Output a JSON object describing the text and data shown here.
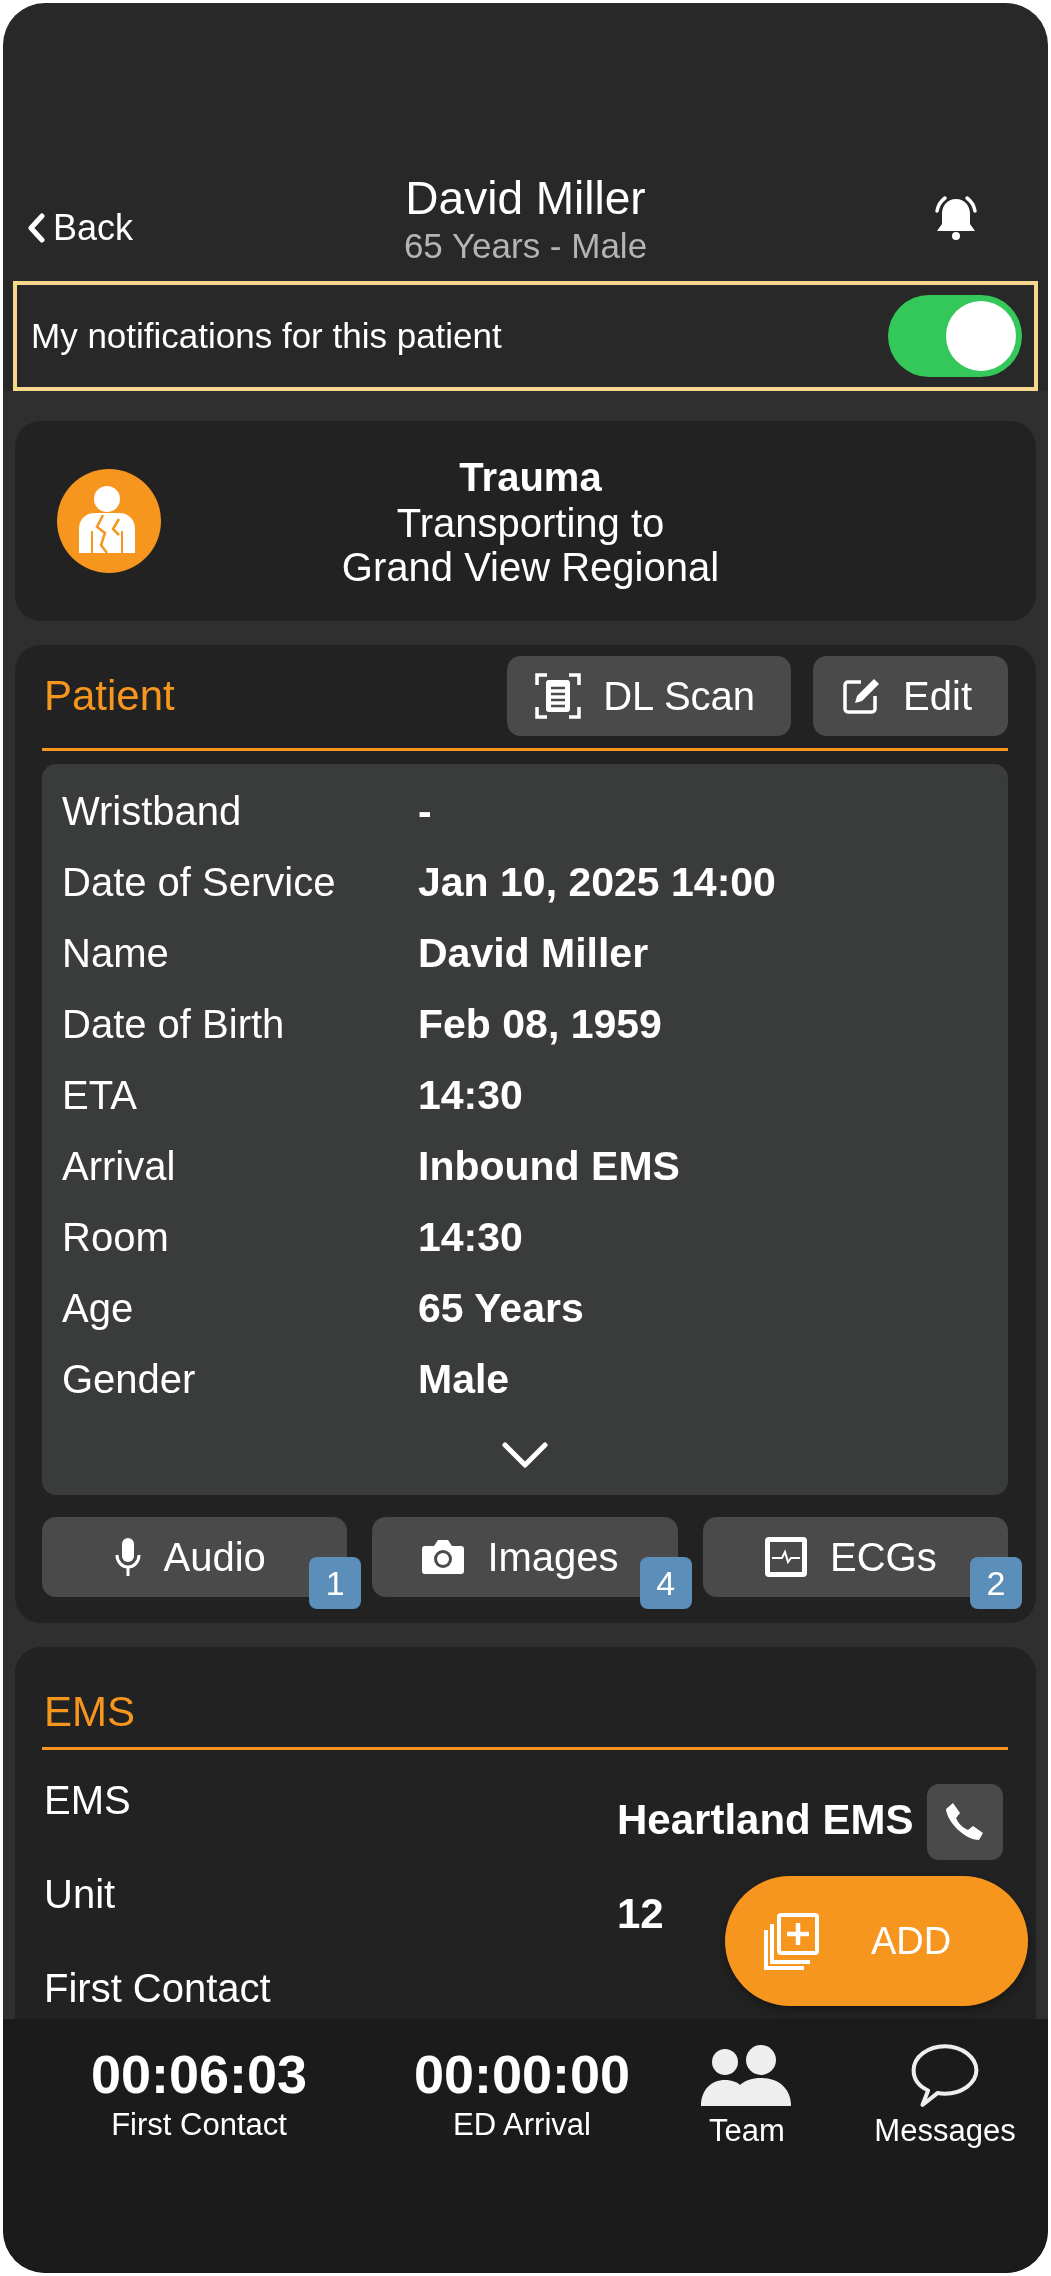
{
  "header": {
    "back": "Back",
    "title": "David Miller",
    "subtitle": "65 Years - Male"
  },
  "notification": {
    "label": "My notifications for this patient",
    "on": true
  },
  "status": {
    "title": "Trauma",
    "lines": [
      "Transporting to",
      "Grand View Regional"
    ]
  },
  "patient": {
    "title": "Patient",
    "actions": [
      {
        "kind": "scan",
        "label": "DL Scan"
      },
      {
        "kind": "edit",
        "label": "Edit"
      }
    ],
    "fields": [
      {
        "label": "Wristband",
        "value": "-"
      },
      {
        "label": "Date of Service",
        "value": "Jan 10, 2025 14:00"
      },
      {
        "label": "Name",
        "value": "David Miller"
      },
      {
        "label": "Date of Birth",
        "value": "Feb 08, 1959"
      },
      {
        "label": "ETA",
        "value": "14:30"
      },
      {
        "label": "Arrival",
        "value": "Inbound EMS"
      },
      {
        "label": "Room",
        "value": "14:30"
      },
      {
        "label": "Age",
        "value": "65 Years"
      },
      {
        "label": "Gender",
        "value": "Male"
      }
    ],
    "media": [
      {
        "kind": "mic",
        "label": "Audio",
        "count": "1"
      },
      {
        "kind": "camera",
        "label": "Images",
        "count": "4"
      },
      {
        "kind": "ecg",
        "label": "ECGs",
        "count": "2"
      }
    ]
  },
  "ems": {
    "title": "EMS",
    "rows": [
      {
        "label": "EMS",
        "value": "Heartland EMS"
      },
      {
        "label": "Unit",
        "value": "12"
      },
      {
        "label": "First Contact"
      }
    ]
  },
  "add_button": "ADD",
  "bottom_bar": {
    "timers": [
      {
        "value": "00:06:03",
        "label": "First Contact"
      },
      {
        "value": "00:00:00",
        "label": "ED Arrival"
      }
    ],
    "tabs": [
      {
        "kind": "team",
        "label": "Team"
      },
      {
        "kind": "messages",
        "label": "Messages"
      }
    ]
  }
}
